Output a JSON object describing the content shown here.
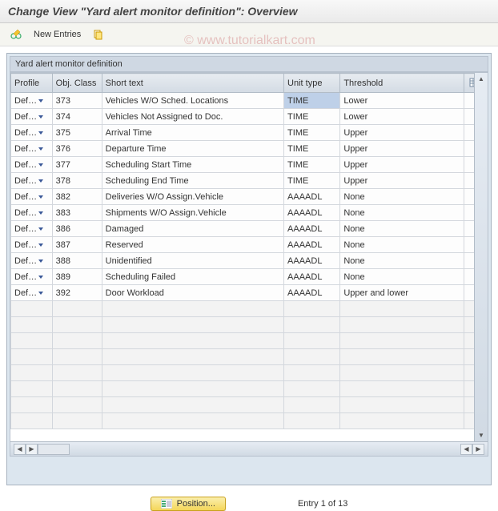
{
  "title": "Change View \"Yard alert monitor definition\": Overview",
  "toolbar": {
    "change_icon": "toggle-display-change",
    "new_entries_label": "New Entries",
    "copy_icon": "copy-as"
  },
  "watermark": "© www.tutorialkart.com",
  "table_title": "Yard alert monitor definition",
  "columns": {
    "profile": "Profile",
    "obj_class": "Obj. Class",
    "short_text": "Short text",
    "unit_type": "Unit type",
    "threshold": "Threshold"
  },
  "rows": [
    {
      "profile": "Def…",
      "obj_class": "373",
      "short_text": "Vehicles W/O Sched. Locations",
      "unit_type": "TIME",
      "threshold": "Lower",
      "selected": true
    },
    {
      "profile": "Def…",
      "obj_class": "374",
      "short_text": "Vehicles Not Assigned to Doc.",
      "unit_type": "TIME",
      "threshold": "Lower"
    },
    {
      "profile": "Def…",
      "obj_class": "375",
      "short_text": "Arrival Time",
      "unit_type": "TIME",
      "threshold": "Upper"
    },
    {
      "profile": "Def…",
      "obj_class": "376",
      "short_text": "Departure Time",
      "unit_type": "TIME",
      "threshold": "Upper"
    },
    {
      "profile": "Def…",
      "obj_class": "377",
      "short_text": "Scheduling Start Time",
      "unit_type": "TIME",
      "threshold": "Upper"
    },
    {
      "profile": "Def…",
      "obj_class": "378",
      "short_text": "Scheduling End Time",
      "unit_type": "TIME",
      "threshold": "Upper"
    },
    {
      "profile": "Def…",
      "obj_class": "382",
      "short_text": "Deliveries W/O Assign.Vehicle",
      "unit_type": "AAAADL",
      "threshold": "None"
    },
    {
      "profile": "Def…",
      "obj_class": "383",
      "short_text": "Shipments W/O Assign.Vehicle",
      "unit_type": "AAAADL",
      "threshold": "None"
    },
    {
      "profile": "Def…",
      "obj_class": "386",
      "short_text": "Damaged",
      "unit_type": "AAAADL",
      "threshold": "None"
    },
    {
      "profile": "Def…",
      "obj_class": "387",
      "short_text": "Reserved",
      "unit_type": "AAAADL",
      "threshold": "None"
    },
    {
      "profile": "Def…",
      "obj_class": "388",
      "short_text": "Unidentified",
      "unit_type": "AAAADL",
      "threshold": "None"
    },
    {
      "profile": "Def…",
      "obj_class": "389",
      "short_text": "Scheduling Failed",
      "unit_type": "AAAADL",
      "threshold": "None"
    },
    {
      "profile": "Def…",
      "obj_class": "392",
      "short_text": "Door Workload",
      "unit_type": "AAAADL",
      "threshold": "Upper and lower"
    }
  ],
  "empty_rows": 8,
  "footer": {
    "position_label": "Position...",
    "entry_text": "Entry 1 of 13"
  }
}
